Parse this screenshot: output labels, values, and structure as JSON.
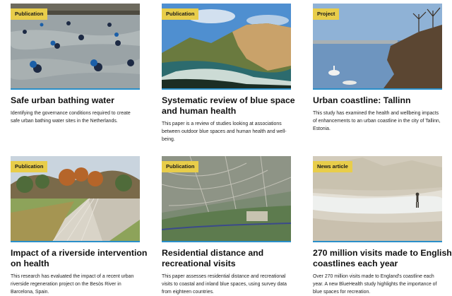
{
  "cards": [
    {
      "badge": "Publication",
      "title_lines": [
        "Safe urban bathing water"
      ],
      "desc_lines": [
        "Identifying the governance conditions required to create",
        "safe urban bathing water sites in the Netherlands."
      ]
    },
    {
      "badge": "Publication",
      "title_lines": [
        "Systematic review of blue space",
        "and human health"
      ],
      "desc_lines": [
        "This paper is a review of studies looking at associations",
        "between outdoor blue spaces and human health and well-",
        "being."
      ]
    },
    {
      "badge": "Project",
      "title_lines": [
        "Urban coastline: Tallinn"
      ],
      "desc_lines": [
        "This study has examined the health and wellbeing impacts",
        "of enhancements to an urban coastline in the city of Tallinn,",
        "Estonia."
      ]
    },
    {
      "badge": "Publication",
      "title_lines": [
        "Impact of a riverside intervention",
        "on health"
      ],
      "desc_lines": [
        "This research has evaluated the impact of a recent urban",
        "riverside regeneration project on the Besòs River in",
        "Barcelona, Spain."
      ]
    },
    {
      "badge": "Publication",
      "title_lines": [
        "Residential distance and",
        "recreational visits"
      ],
      "desc_lines": [
        "This paper assesses residential distance and recreational",
        "visits to coastal and inland blue spaces, using survey data",
        "from eighteen countries."
      ]
    },
    {
      "badge": "News article",
      "title_lines": [
        "270 million visits made to English",
        "coastlines each year"
      ],
      "desc_lines": [
        "Over 270 million visits made to England's coastline each",
        "year. A new BlueHealth study highlights the importance of",
        "blue spaces for recreation."
      ]
    }
  ],
  "colors": {
    "badge": "#e8cd4a",
    "accent_rule": "#2a8fc9"
  }
}
